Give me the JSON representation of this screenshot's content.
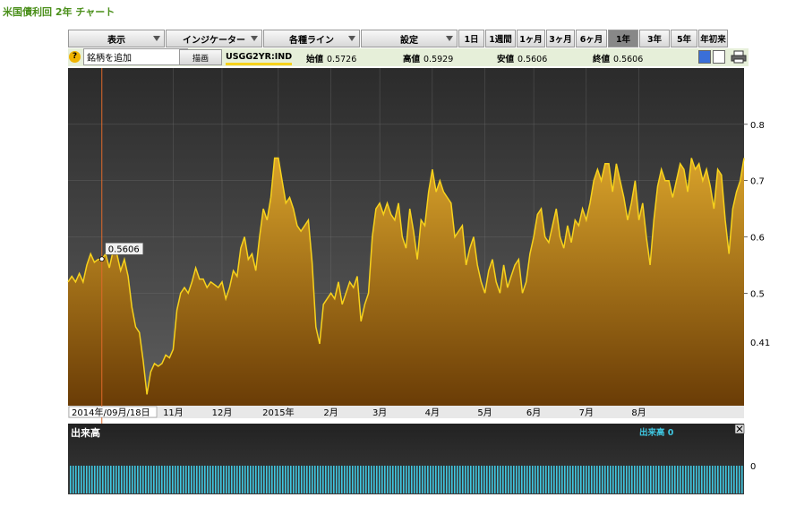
{
  "page": {
    "title": "米国債利回 2年 チャート"
  },
  "menus": [
    {
      "label": "表示"
    },
    {
      "label": "インジケーター"
    },
    {
      "label": "各種ライン"
    },
    {
      "label": "設定"
    }
  ],
  "ranges": [
    {
      "label": "1日",
      "active": false
    },
    {
      "label": "1週間",
      "active": false
    },
    {
      "label": "1ヶ月",
      "active": false
    },
    {
      "label": "3ヶ月",
      "active": false
    },
    {
      "label": "6ヶ月",
      "active": false
    },
    {
      "label": "1年",
      "active": true
    },
    {
      "label": "3年",
      "active": false
    },
    {
      "label": "5年",
      "active": false
    },
    {
      "label": "年初来",
      "active": false
    }
  ],
  "info": {
    "symbol_value": "銘柄を追加",
    "draw_label": "描画",
    "ticker": "USGG2YR:IND",
    "stats": [
      {
        "label": "始値",
        "value": "0.5726"
      },
      {
        "label": "高値",
        "value": "0.5929"
      },
      {
        "label": "安値",
        "value": "0.5606"
      },
      {
        "label": "終値",
        "value": "0.5606"
      }
    ]
  },
  "colors": {
    "accent": "#f7d21c",
    "volume": "#3fc6e0",
    "cursor": "#e06a2a",
    "title": "#4a8f1a"
  },
  "chart_data": {
    "type": "area",
    "ylim": [
      0.3,
      0.9
    ],
    "yticks": [
      "0.8",
      "0.7",
      "0.6",
      "0.5"
    ],
    "last_value_label": "0.41",
    "cursor": {
      "date_label": "2014年/09月/18日",
      "value_label": "0.5606",
      "value": 0.5606,
      "index": 9
    },
    "month_labels": [
      {
        "label": "11月",
        "index": 28
      },
      {
        "label": "12月",
        "index": 41
      },
      {
        "label": "2015年",
        "index": 56
      },
      {
        "label": "2月",
        "index": 70
      },
      {
        "label": "3月",
        "index": 83
      },
      {
        "label": "4月",
        "index": 97
      },
      {
        "label": "5月",
        "index": 111
      },
      {
        "label": "6月",
        "index": 124
      },
      {
        "label": "7月",
        "index": 138
      },
      {
        "label": "8月",
        "index": 152
      }
    ],
    "values": [
      0.52,
      0.53,
      0.52,
      0.535,
      0.52,
      0.55,
      0.57,
      0.555,
      0.56,
      0.56,
      0.57,
      0.545,
      0.575,
      0.57,
      0.54,
      0.56,
      0.53,
      0.475,
      0.44,
      0.43,
      0.38,
      0.32,
      0.36,
      0.375,
      0.37,
      0.375,
      0.39,
      0.385,
      0.4,
      0.47,
      0.5,
      0.51,
      0.5,
      0.52,
      0.545,
      0.525,
      0.525,
      0.51,
      0.52,
      0.515,
      0.51,
      0.52,
      0.49,
      0.51,
      0.54,
      0.53,
      0.58,
      0.6,
      0.56,
      0.57,
      0.54,
      0.6,
      0.65,
      0.63,
      0.67,
      0.74,
      0.74,
      0.7,
      0.66,
      0.67,
      0.65,
      0.62,
      0.61,
      0.62,
      0.63,
      0.555,
      0.44,
      0.41,
      0.48,
      0.49,
      0.5,
      0.49,
      0.52,
      0.48,
      0.5,
      0.52,
      0.51,
      0.53,
      0.45,
      0.48,
      0.5,
      0.6,
      0.65,
      0.66,
      0.64,
      0.66,
      0.64,
      0.63,
      0.66,
      0.6,
      0.58,
      0.65,
      0.61,
      0.56,
      0.63,
      0.62,
      0.68,
      0.72,
      0.68,
      0.7,
      0.68,
      0.67,
      0.66,
      0.6,
      0.61,
      0.62,
      0.55,
      0.58,
      0.6,
      0.55,
      0.52,
      0.5,
      0.54,
      0.56,
      0.52,
      0.5,
      0.55,
      0.51,
      0.53,
      0.55,
      0.56,
      0.5,
      0.52,
      0.57,
      0.6,
      0.64,
      0.65,
      0.6,
      0.59,
      0.62,
      0.65,
      0.6,
      0.58,
      0.62,
      0.59,
      0.63,
      0.62,
      0.65,
      0.63,
      0.66,
      0.7,
      0.72,
      0.7,
      0.73,
      0.73,
      0.68,
      0.73,
      0.7,
      0.67,
      0.63,
      0.66,
      0.7,
      0.63,
      0.66,
      0.6,
      0.55,
      0.63,
      0.69,
      0.72,
      0.7,
      0.7,
      0.67,
      0.7,
      0.73,
      0.72,
      0.68,
      0.74,
      0.72,
      0.73,
      0.7,
      0.72,
      0.69,
      0.65,
      0.72,
      0.71,
      0.63,
      0.57,
      0.65,
      0.68,
      0.7,
      0.74
    ],
    "volume": {
      "title": "出来高",
      "label": "出来高 0",
      "zero_label": "0"
    }
  }
}
